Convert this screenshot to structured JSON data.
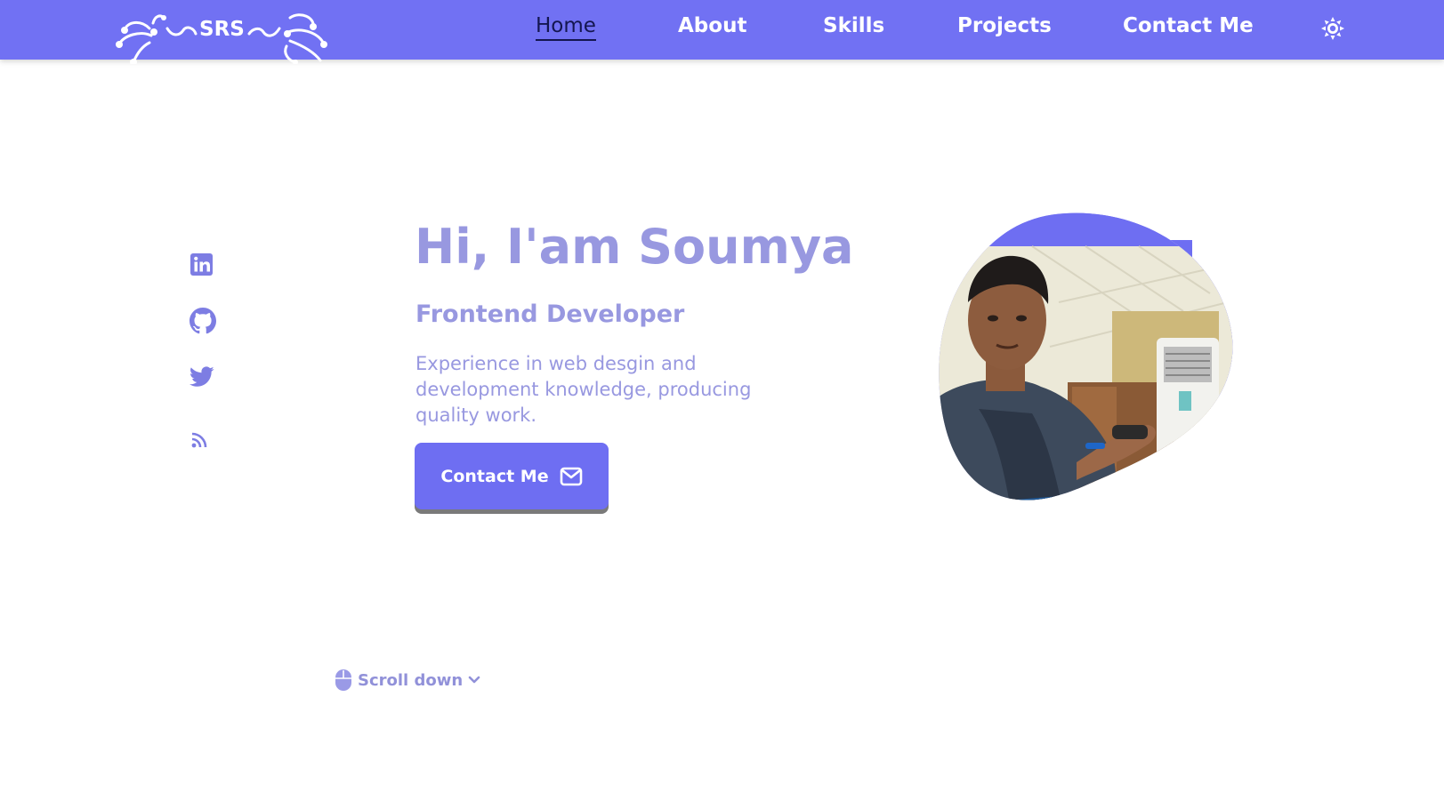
{
  "colors": {
    "header_bg": "#7171f3",
    "accent": "#6e6ef2",
    "text_soft": "#9898e0",
    "active_nav": "#141650"
  },
  "brand": {
    "logo_text": "SRS"
  },
  "nav": {
    "items": [
      {
        "label": "Home",
        "active": true
      },
      {
        "label": "About",
        "active": false
      },
      {
        "label": "Skills",
        "active": false
      },
      {
        "label": "Projects",
        "active": false
      },
      {
        "label": "Contact Me",
        "active": false
      }
    ],
    "theme_icon": "sun-icon"
  },
  "social": {
    "icons": [
      "linkedin-icon",
      "github-icon",
      "twitter-icon",
      "rss-icon"
    ]
  },
  "hero": {
    "title": "Hi, I'am Soumya",
    "subtitle": "Frontend Developer",
    "description": "Experience in web desgin and development knowledge, producing quality work.",
    "button_label": "Contact Me",
    "button_icon": "mail-icon",
    "photo": "profile-photo"
  },
  "scroll": {
    "label": "Scroll down",
    "icons": [
      "mouse-icon",
      "chevron-down-icon"
    ]
  }
}
